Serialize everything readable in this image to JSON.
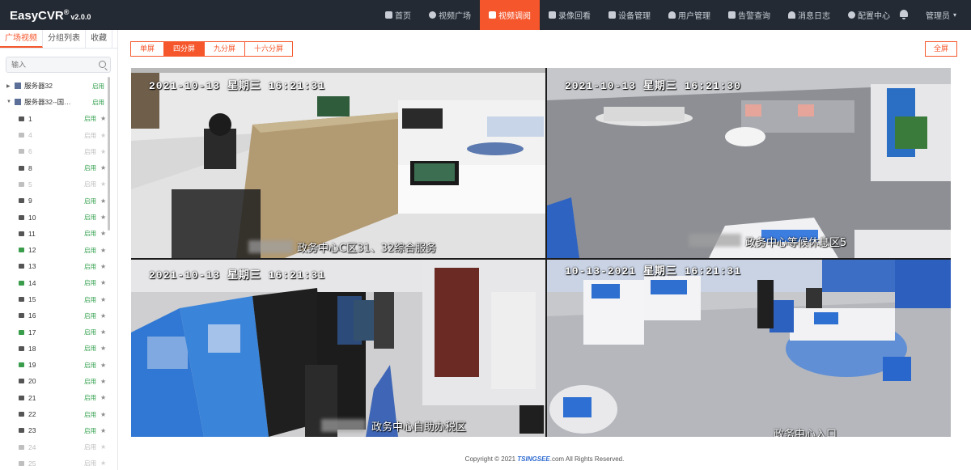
{
  "app": {
    "name": "EasyCVR",
    "reg": "®",
    "version": "v2.0.0"
  },
  "nav": [
    {
      "label": "首页"
    },
    {
      "label": "视频广场"
    },
    {
      "label": "视频调阅",
      "active": true
    },
    {
      "label": "录像回看"
    },
    {
      "label": "设备管理"
    },
    {
      "label": "用户管理"
    },
    {
      "label": "告警查询"
    },
    {
      "label": "消息日志"
    },
    {
      "label": "配置中心"
    }
  ],
  "user": {
    "label": "管理员"
  },
  "sidebar": {
    "tabs": [
      "广场视频",
      "分组列表",
      "收藏"
    ],
    "search_placeholder": "输入",
    "servers": [
      {
        "name": "服务器32",
        "status": "启用",
        "expanded": false
      },
      {
        "name": "服务器32--国税...",
        "status": "启用",
        "expanded": true
      }
    ],
    "channels": [
      {
        "name": "1",
        "status": "启用",
        "online": true
      },
      {
        "name": "4",
        "status": "启用",
        "online": false
      },
      {
        "name": "6",
        "status": "启用",
        "online": false
      },
      {
        "name": "8",
        "status": "启用",
        "online": true
      },
      {
        "name": "5",
        "status": "启用",
        "online": false
      },
      {
        "name": "9",
        "status": "启用",
        "online": true
      },
      {
        "name": "10",
        "status": "启用",
        "online": true
      },
      {
        "name": "11",
        "status": "启用",
        "online": true
      },
      {
        "name": "12",
        "status": "启用",
        "online": true,
        "green": true
      },
      {
        "name": "13",
        "status": "启用",
        "online": true
      },
      {
        "name": "14",
        "status": "启用",
        "online": true,
        "green": true
      },
      {
        "name": "15",
        "status": "启用",
        "online": true
      },
      {
        "name": "16",
        "status": "启用",
        "online": true
      },
      {
        "name": "17",
        "status": "启用",
        "online": true,
        "green": true
      },
      {
        "name": "18",
        "status": "启用",
        "online": true
      },
      {
        "name": "19",
        "status": "启用",
        "online": true,
        "green": true
      },
      {
        "name": "20",
        "status": "启用",
        "online": true
      },
      {
        "name": "21",
        "status": "启用",
        "online": true
      },
      {
        "name": "22",
        "status": "启用",
        "online": true
      },
      {
        "name": "23",
        "status": "启用",
        "online": true
      },
      {
        "name": "24",
        "status": "启用",
        "online": false
      },
      {
        "name": "25",
        "status": "启用",
        "online": false
      }
    ]
  },
  "toolbar": {
    "split_options": [
      "单屏",
      "四分屏",
      "九分屏",
      "十六分屏"
    ],
    "active_split": "四分屏",
    "fullscreen_label": "全屏"
  },
  "videos": [
    {
      "timestamp": "2021-10-13  星期三  16:21:31",
      "caption": "政务中心C区31、32综合服务"
    },
    {
      "timestamp": "2021-10-13  星期三  16:21:30",
      "caption": "政务中心等候休息区5"
    },
    {
      "timestamp": "2021-10-13  星期三  16:21:31",
      "caption": "政务中心自助办税区"
    },
    {
      "timestamp": "10-13-2021  星期三  16:21:31",
      "caption": "政务中心入口"
    }
  ],
  "footer": {
    "prefix": "Copyright © 2021 ",
    "brand": "TSINGSEE",
    "suffix": ".com All Rights Reserved."
  }
}
